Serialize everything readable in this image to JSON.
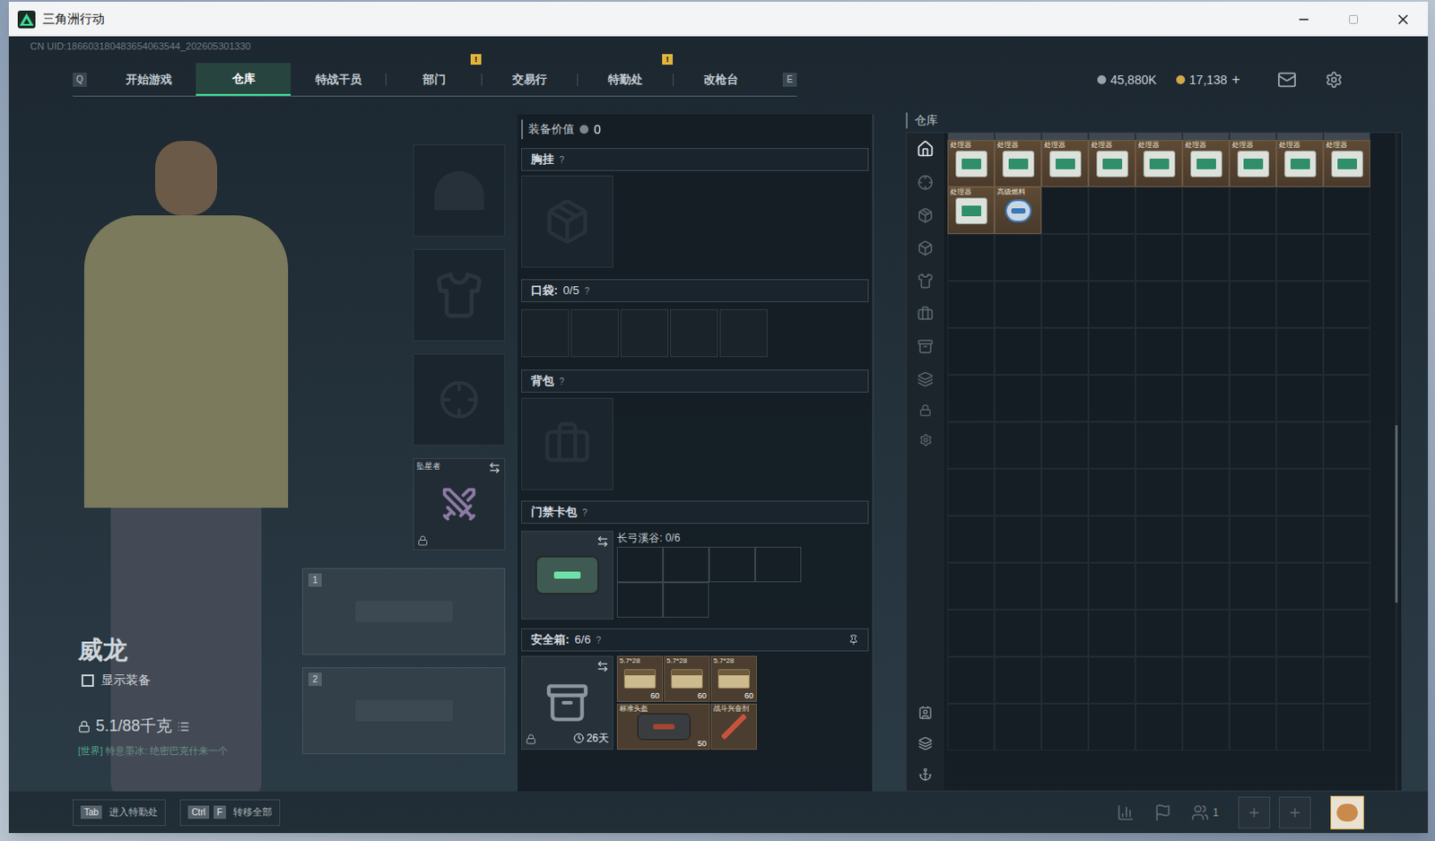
{
  "window": {
    "title": "三角洲行动"
  },
  "uid": "CN UID:186603180483654063544_202605301330",
  "nav": {
    "left_key": "Q",
    "right_key": "E",
    "tabs": [
      {
        "label": "开始游戏",
        "selected": false,
        "badge": ""
      },
      {
        "label": "仓库",
        "selected": true,
        "badge": ""
      },
      {
        "label": "特战干员",
        "selected": false,
        "badge": ""
      },
      {
        "label": "部门",
        "selected": false,
        "badge": "!"
      },
      {
        "label": "交易行",
        "selected": false,
        "badge": ""
      },
      {
        "label": "特勤处",
        "selected": false,
        "badge": "!"
      },
      {
        "label": "改枪台",
        "selected": false,
        "badge": ""
      }
    ]
  },
  "currencies": [
    {
      "value": "45,880K",
      "add": "",
      "color": "#9aa3ab"
    },
    {
      "value": "17,138",
      "add": "+",
      "color": "#d4a84a"
    }
  ],
  "character": {
    "name": "威龙",
    "show_equipment": {
      "label": "显示装备",
      "checked": false
    },
    "weight": "5.1/88千克",
    "chat_channel": "[世界]",
    "chat": "特意墨冰: 绝密巴克什来一个"
  },
  "gear_slots": {
    "melee": {
      "name": "坠星者",
      "locked": true
    },
    "weapon_slots": [
      "1",
      "2"
    ]
  },
  "loadout": {
    "value_label": "装备价值",
    "value": "0",
    "help": "?",
    "chest_rig": {
      "title": "胸挂"
    },
    "pockets": {
      "title": "口袋:",
      "count": "0/5",
      "slots": [
        {
          "filled": false
        },
        {
          "filled": false
        },
        {
          "filled": false
        },
        {
          "filled": false
        },
        {
          "filled": false
        }
      ]
    },
    "backpack": {
      "title": "背包"
    },
    "keycard": {
      "title": "门禁卡包",
      "map": "长弓溪谷: 0/6",
      "slots": [
        {
          "filled": false
        },
        {
          "filled": false
        },
        {
          "filled": false
        },
        {
          "filled": false
        },
        {
          "filled": false
        },
        {
          "filled": false
        }
      ]
    },
    "safe_box": {
      "title": "安全箱:",
      "count": "6/6",
      "pinned": true,
      "locked": true,
      "timer": "26天",
      "items": [
        {
          "name": "5.7*28",
          "count": "60",
          "kind": "ammo"
        },
        {
          "name": "5.7*28",
          "count": "60",
          "kind": "ammo"
        },
        {
          "name": "5.7*28",
          "count": "60",
          "kind": "ammo"
        },
        {
          "name": "标准头盔",
          "count": "50",
          "kind": "bag"
        },
        {
          "name": "战斗兴奋剂",
          "count": "",
          "kind": "syringe"
        }
      ]
    }
  },
  "stash": {
    "title": "仓库",
    "items": [
      {
        "name": "处理器",
        "kind": "processor"
      },
      {
        "name": "处理器",
        "kind": "processor"
      },
      {
        "name": "处理器",
        "kind": "processor"
      },
      {
        "name": "处理器",
        "kind": "processor"
      },
      {
        "name": "处理器",
        "kind": "processor"
      },
      {
        "name": "处理器",
        "kind": "processor"
      },
      {
        "name": "处理器",
        "kind": "processor"
      },
      {
        "name": "处理器",
        "kind": "processor"
      },
      {
        "name": "处理器",
        "kind": "processor"
      },
      {
        "name": "处理器",
        "kind": "processor"
      },
      {
        "name": "高级燃料",
        "kind": "fuel"
      }
    ]
  },
  "hints": [
    {
      "keys": [
        "Tab"
      ],
      "label": "进入特勤处"
    },
    {
      "keys": [
        "Ctrl",
        "F"
      ],
      "label": "转移全部"
    }
  ],
  "squad": {
    "count": "1"
  }
}
